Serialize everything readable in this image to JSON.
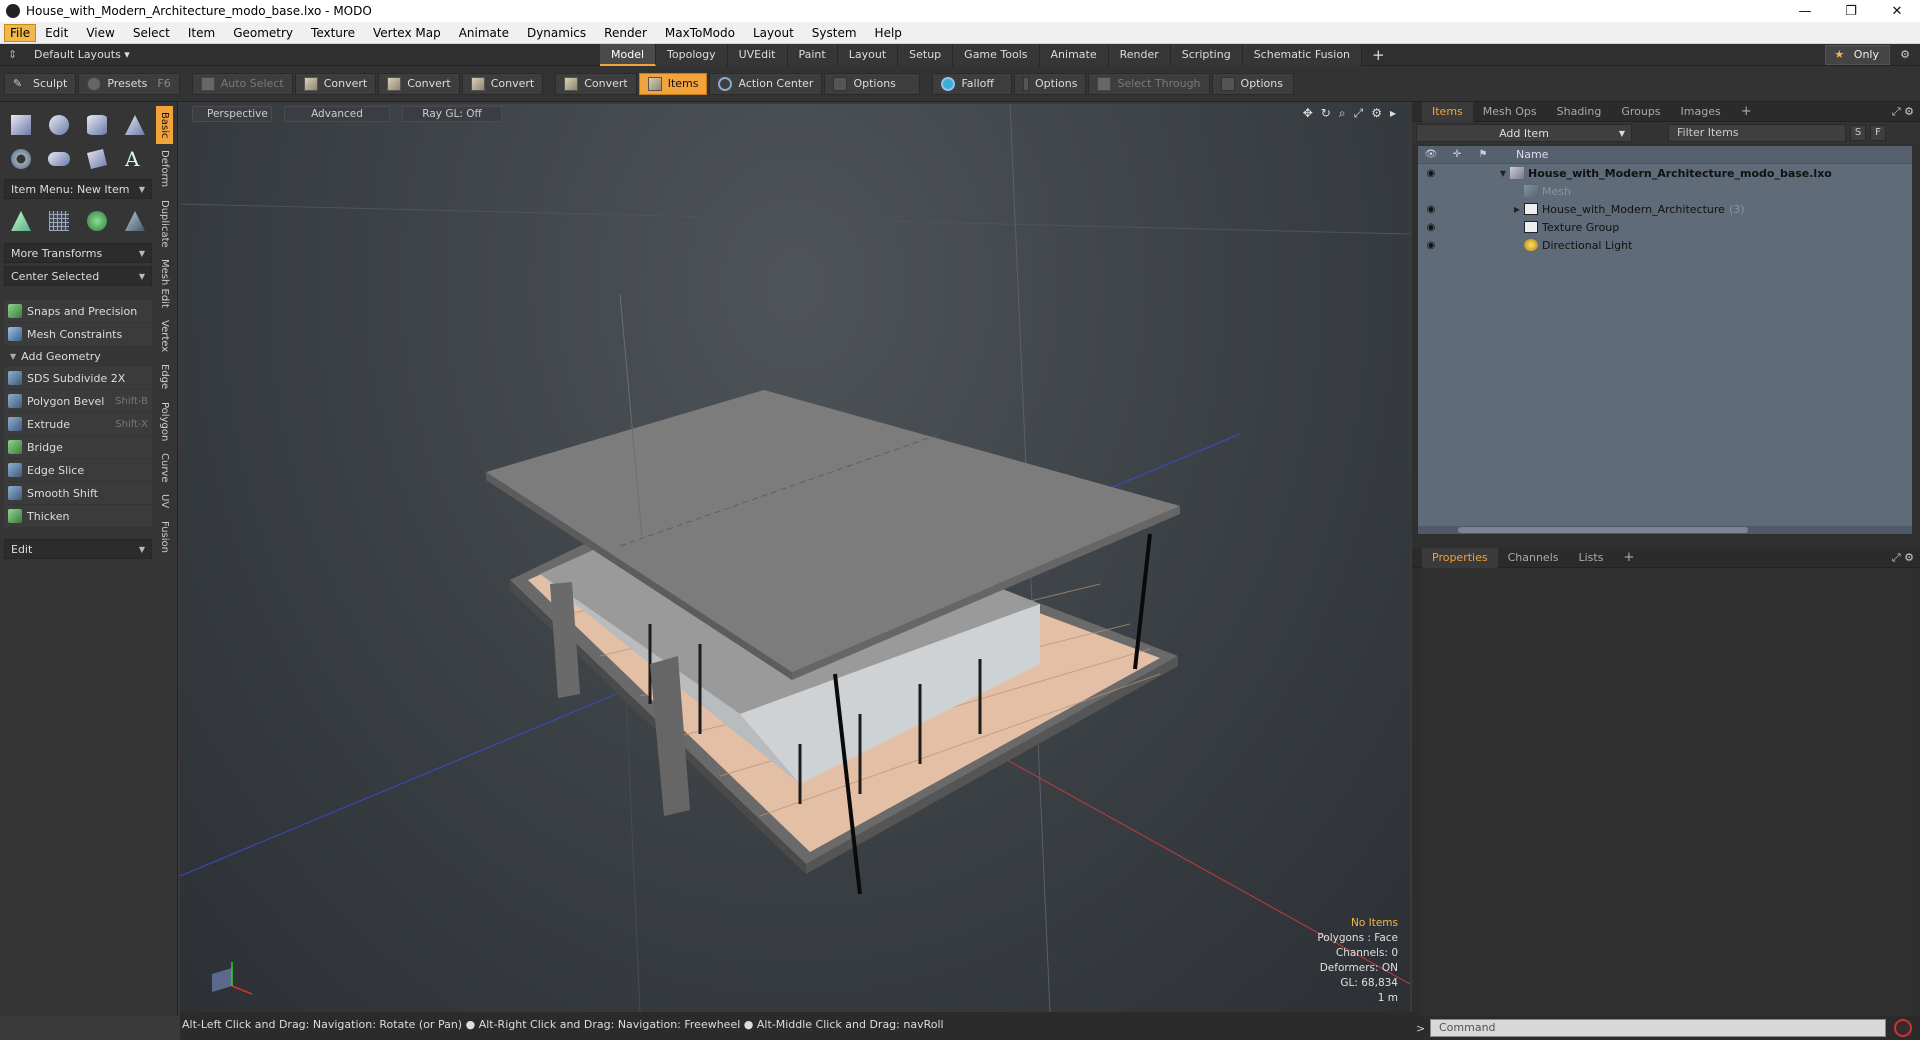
{
  "window": {
    "title": "House_with_Modern_Architecture_modo_base.lxo - MODO",
    "controls": [
      "—",
      "❐",
      "✕"
    ]
  },
  "menu": [
    "File",
    "Edit",
    "View",
    "Select",
    "Item",
    "Geometry",
    "Texture",
    "Vertex Map",
    "Animate",
    "Dynamics",
    "Render",
    "MaxToModo",
    "Layout",
    "System",
    "Help"
  ],
  "layoutbar": {
    "layouts": "Default Layouts ▾",
    "tabs": [
      "Model",
      "Topology",
      "UVEdit",
      "Paint",
      "Layout",
      "Setup",
      "Game Tools",
      "Animate",
      "Render",
      "Scripting",
      "Schematic Fusion"
    ],
    "active_tab": "Model",
    "add": "+",
    "only": "Only",
    "star": "★",
    "gear": "⚙"
  },
  "toolbar": {
    "sculpt": "Sculpt",
    "presets": "Presets",
    "presets_key": "F6",
    "auto_select": "Auto Select",
    "convert1": "Convert",
    "convert2": "Convert",
    "convert3": "Convert",
    "convert4": "Convert",
    "items": "Items",
    "action_center": "Action Center",
    "options1": "Options",
    "falloff": "Falloff",
    "options2": "Options",
    "select_through": "Select Through",
    "options3": "Options"
  },
  "leftpanel": {
    "item_menu": "Item Menu: New Item",
    "more_transforms": "More Transforms",
    "center_selected": "Center Selected",
    "snaps": "Snaps and Precision",
    "mesh_constraints": "Mesh Constraints",
    "add_geometry": "Add Geometry",
    "tools": [
      {
        "label": "SDS Subdivide 2X",
        "key": ""
      },
      {
        "label": "Polygon Bevel",
        "key": "Shift-B"
      },
      {
        "label": "Extrude",
        "key": "Shift-X"
      },
      {
        "label": "Bridge",
        "key": ""
      },
      {
        "label": "Edge Slice",
        "key": ""
      },
      {
        "label": "Smooth Shift",
        "key": ""
      },
      {
        "label": "Thicken",
        "key": ""
      }
    ],
    "edit_dd": "Edit",
    "vtabs": [
      "Basic",
      "Deform",
      "Duplicate",
      "Mesh Edit",
      "Vertex",
      "Edge",
      "Polygon",
      "Curve",
      "UV",
      "Fusion"
    ]
  },
  "viewport": {
    "view": "Perspective",
    "shading": "Advanced",
    "raygl": "Ray GL: Off",
    "info": {
      "no_items": "No Items",
      "polygons": "Polygons : Face",
      "channels": "Channels: 0",
      "deformers": "Deformers: ON",
      "gl": "GL: 68,834",
      "scale": "1 m"
    }
  },
  "status": "Alt-Left Click and Drag: Navigation: Rotate (or Pan) ● Alt-Right Click and Drag: Navigation: Freewheel ● Alt-Middle Click and Drag: navRoll",
  "items_panel": {
    "tabs": [
      "Items",
      "Mesh Ops",
      "Shading",
      "Groups",
      "Images"
    ],
    "add_item": "Add Item",
    "filter": "Filter Items",
    "s_btn": "S",
    "f_btn": "F",
    "name_col": "Name",
    "rows": [
      {
        "label": "House_with_Modern_Architecture_modo_base.lxo",
        "count": ""
      },
      {
        "label": "Mesh",
        "count": ""
      },
      {
        "label": "House_with_Modern_Architecture",
        "count": "(3)"
      },
      {
        "label": "Texture Group",
        "count": ""
      },
      {
        "label": "Directional Light",
        "count": ""
      }
    ]
  },
  "props_panel": {
    "tabs": [
      "Properties",
      "Channels",
      "Lists"
    ]
  },
  "command": {
    "placeholder": "Command"
  }
}
